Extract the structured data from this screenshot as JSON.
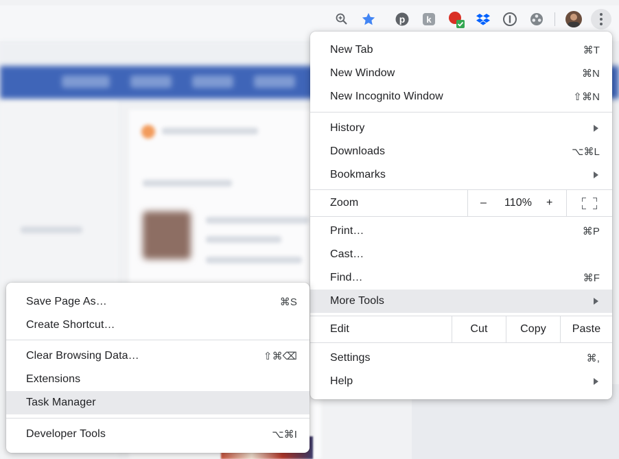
{
  "toolbar": {
    "icons": [
      "zoom-icon",
      "bookmark-star-icon",
      "pinterest-icon",
      "extension-k-icon",
      "extension-badge-icon",
      "dropbox-icon",
      "onepassword-icon",
      "film-icon",
      "profile-avatar",
      "more-menu-icon"
    ],
    "accent": "#4285f4"
  },
  "main_menu": {
    "new_tab": {
      "label": "New Tab",
      "shortcut": "⌘T"
    },
    "new_window": {
      "label": "New Window",
      "shortcut": "⌘N"
    },
    "new_incognito": {
      "label": "New Incognito Window",
      "shortcut": "⇧⌘N"
    },
    "history": {
      "label": "History"
    },
    "downloads": {
      "label": "Downloads",
      "shortcut": "⌥⌘L"
    },
    "bookmarks": {
      "label": "Bookmarks"
    },
    "zoom": {
      "label": "Zoom",
      "minus": "–",
      "value": "110%",
      "plus": "+"
    },
    "print": {
      "label": "Print…",
      "shortcut": "⌘P"
    },
    "cast": {
      "label": "Cast…"
    },
    "find": {
      "label": "Find…",
      "shortcut": "⌘F"
    },
    "more_tools": {
      "label": "More Tools"
    },
    "edit": {
      "label": "Edit",
      "cut": "Cut",
      "copy": "Copy",
      "paste": "Paste"
    },
    "settings": {
      "label": "Settings",
      "shortcut": "⌘,"
    },
    "help": {
      "label": "Help"
    }
  },
  "sub_menu": {
    "save_page": {
      "label": "Save Page As…",
      "shortcut": "⌘S"
    },
    "create_shortcut": {
      "label": "Create Shortcut…"
    },
    "clear_data": {
      "label": "Clear Browsing Data…",
      "shortcut": "⇧⌘⌫"
    },
    "extensions": {
      "label": "Extensions"
    },
    "task_manager": {
      "label": "Task Manager"
    },
    "developer_tools": {
      "label": "Developer Tools",
      "shortcut": "⌥⌘I"
    }
  },
  "highlight_color": "#e8e9ec"
}
